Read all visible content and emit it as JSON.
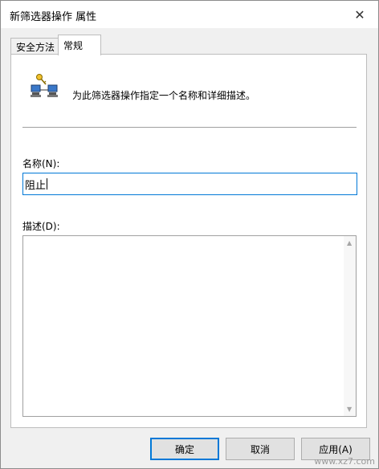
{
  "window": {
    "title": "新筛选器操作 属性",
    "close_glyph": "✕"
  },
  "tabs": [
    {
      "label": "安全方法",
      "active": false
    },
    {
      "label": "常规",
      "active": true
    }
  ],
  "general": {
    "header_icon": "network-filter-icon",
    "description_text": "为此筛选器操作指定一个名称和详细描述。",
    "name_label": "名称(N):",
    "name_value": "阻止",
    "desc_label": "描述(D):",
    "desc_value": ""
  },
  "buttons": {
    "ok": "确定",
    "cancel": "取消",
    "apply": "应用(A)"
  },
  "watermark": "www.xz7.com",
  "colors": {
    "accent": "#0078d7",
    "panel_bg": "#ffffff",
    "window_bg": "#f0f0f0"
  }
}
